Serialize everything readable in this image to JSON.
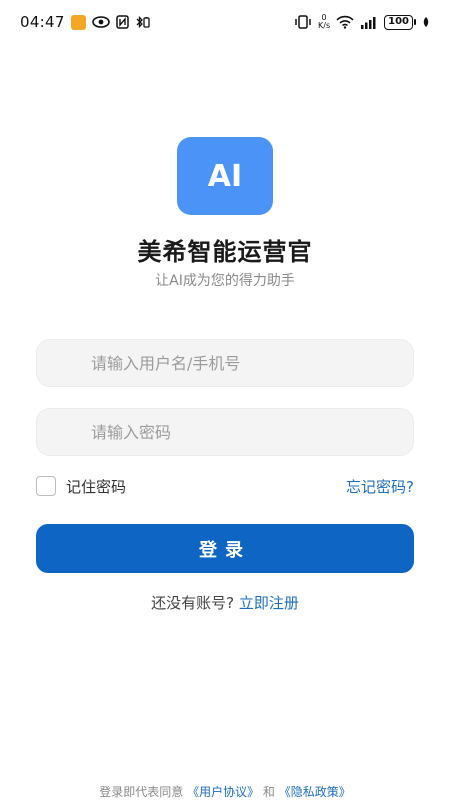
{
  "status_bar": {
    "time": "04:47",
    "netspeed_value": "0",
    "netspeed_unit": "K/s",
    "battery": "100"
  },
  "logo": {
    "text": "AI",
    "color": "#4b93f7"
  },
  "app": {
    "title": "美希智能运营官",
    "subtitle": "让AI成为您的得力助手"
  },
  "form": {
    "username_placeholder": "请输入用户名/手机号",
    "username_value": "",
    "password_placeholder": "请输入密码",
    "password_value": "",
    "remember_label": "记住密码",
    "remember_checked": false,
    "forgot_label": "忘记密码?",
    "login_label": "登录"
  },
  "register": {
    "prompt": "还没有账号?",
    "link": "立即注册"
  },
  "agreement": {
    "prefix": "登录即代表同意",
    "user_agreement": "《用户协议》",
    "and": "和",
    "privacy_policy": "《隐私政策》"
  },
  "colors": {
    "accent": "#0f65c4",
    "link": "#1e6fbf",
    "logo_bg": "#4b93f7"
  }
}
